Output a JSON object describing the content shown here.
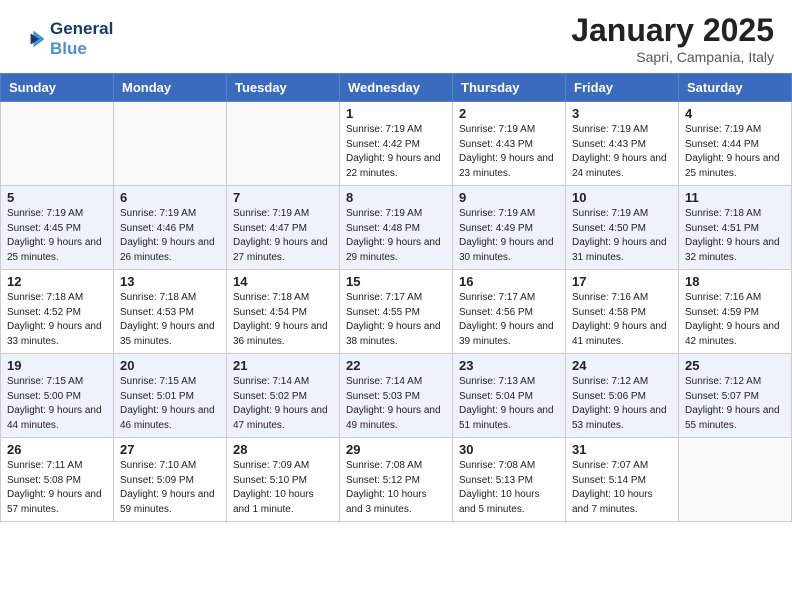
{
  "logo": {
    "line1": "General",
    "line2": "Blue"
  },
  "title": "January 2025",
  "subtitle": "Sapri, Campania, Italy",
  "days_header": [
    "Sunday",
    "Monday",
    "Tuesday",
    "Wednesday",
    "Thursday",
    "Friday",
    "Saturday"
  ],
  "weeks": [
    [
      {
        "day": "",
        "info": ""
      },
      {
        "day": "",
        "info": ""
      },
      {
        "day": "",
        "info": ""
      },
      {
        "day": "1",
        "info": "Sunrise: 7:19 AM\nSunset: 4:42 PM\nDaylight: 9 hours and 22 minutes."
      },
      {
        "day": "2",
        "info": "Sunrise: 7:19 AM\nSunset: 4:43 PM\nDaylight: 9 hours and 23 minutes."
      },
      {
        "day": "3",
        "info": "Sunrise: 7:19 AM\nSunset: 4:43 PM\nDaylight: 9 hours and 24 minutes."
      },
      {
        "day": "4",
        "info": "Sunrise: 7:19 AM\nSunset: 4:44 PM\nDaylight: 9 hours and 25 minutes."
      }
    ],
    [
      {
        "day": "5",
        "info": "Sunrise: 7:19 AM\nSunset: 4:45 PM\nDaylight: 9 hours and 25 minutes."
      },
      {
        "day": "6",
        "info": "Sunrise: 7:19 AM\nSunset: 4:46 PM\nDaylight: 9 hours and 26 minutes."
      },
      {
        "day": "7",
        "info": "Sunrise: 7:19 AM\nSunset: 4:47 PM\nDaylight: 9 hours and 27 minutes."
      },
      {
        "day": "8",
        "info": "Sunrise: 7:19 AM\nSunset: 4:48 PM\nDaylight: 9 hours and 29 minutes."
      },
      {
        "day": "9",
        "info": "Sunrise: 7:19 AM\nSunset: 4:49 PM\nDaylight: 9 hours and 30 minutes."
      },
      {
        "day": "10",
        "info": "Sunrise: 7:19 AM\nSunset: 4:50 PM\nDaylight: 9 hours and 31 minutes."
      },
      {
        "day": "11",
        "info": "Sunrise: 7:18 AM\nSunset: 4:51 PM\nDaylight: 9 hours and 32 minutes."
      }
    ],
    [
      {
        "day": "12",
        "info": "Sunrise: 7:18 AM\nSunset: 4:52 PM\nDaylight: 9 hours and 33 minutes."
      },
      {
        "day": "13",
        "info": "Sunrise: 7:18 AM\nSunset: 4:53 PM\nDaylight: 9 hours and 35 minutes."
      },
      {
        "day": "14",
        "info": "Sunrise: 7:18 AM\nSunset: 4:54 PM\nDaylight: 9 hours and 36 minutes."
      },
      {
        "day": "15",
        "info": "Sunrise: 7:17 AM\nSunset: 4:55 PM\nDaylight: 9 hours and 38 minutes."
      },
      {
        "day": "16",
        "info": "Sunrise: 7:17 AM\nSunset: 4:56 PM\nDaylight: 9 hours and 39 minutes."
      },
      {
        "day": "17",
        "info": "Sunrise: 7:16 AM\nSunset: 4:58 PM\nDaylight: 9 hours and 41 minutes."
      },
      {
        "day": "18",
        "info": "Sunrise: 7:16 AM\nSunset: 4:59 PM\nDaylight: 9 hours and 42 minutes."
      }
    ],
    [
      {
        "day": "19",
        "info": "Sunrise: 7:15 AM\nSunset: 5:00 PM\nDaylight: 9 hours and 44 minutes."
      },
      {
        "day": "20",
        "info": "Sunrise: 7:15 AM\nSunset: 5:01 PM\nDaylight: 9 hours and 46 minutes."
      },
      {
        "day": "21",
        "info": "Sunrise: 7:14 AM\nSunset: 5:02 PM\nDaylight: 9 hours and 47 minutes."
      },
      {
        "day": "22",
        "info": "Sunrise: 7:14 AM\nSunset: 5:03 PM\nDaylight: 9 hours and 49 minutes."
      },
      {
        "day": "23",
        "info": "Sunrise: 7:13 AM\nSunset: 5:04 PM\nDaylight: 9 hours and 51 minutes."
      },
      {
        "day": "24",
        "info": "Sunrise: 7:12 AM\nSunset: 5:06 PM\nDaylight: 9 hours and 53 minutes."
      },
      {
        "day": "25",
        "info": "Sunrise: 7:12 AM\nSunset: 5:07 PM\nDaylight: 9 hours and 55 minutes."
      }
    ],
    [
      {
        "day": "26",
        "info": "Sunrise: 7:11 AM\nSunset: 5:08 PM\nDaylight: 9 hours and 57 minutes."
      },
      {
        "day": "27",
        "info": "Sunrise: 7:10 AM\nSunset: 5:09 PM\nDaylight: 9 hours and 59 minutes."
      },
      {
        "day": "28",
        "info": "Sunrise: 7:09 AM\nSunset: 5:10 PM\nDaylight: 10 hours and 1 minute."
      },
      {
        "day": "29",
        "info": "Sunrise: 7:08 AM\nSunset: 5:12 PM\nDaylight: 10 hours and 3 minutes."
      },
      {
        "day": "30",
        "info": "Sunrise: 7:08 AM\nSunset: 5:13 PM\nDaylight: 10 hours and 5 minutes."
      },
      {
        "day": "31",
        "info": "Sunrise: 7:07 AM\nSunset: 5:14 PM\nDaylight: 10 hours and 7 minutes."
      },
      {
        "day": "",
        "info": ""
      }
    ]
  ]
}
